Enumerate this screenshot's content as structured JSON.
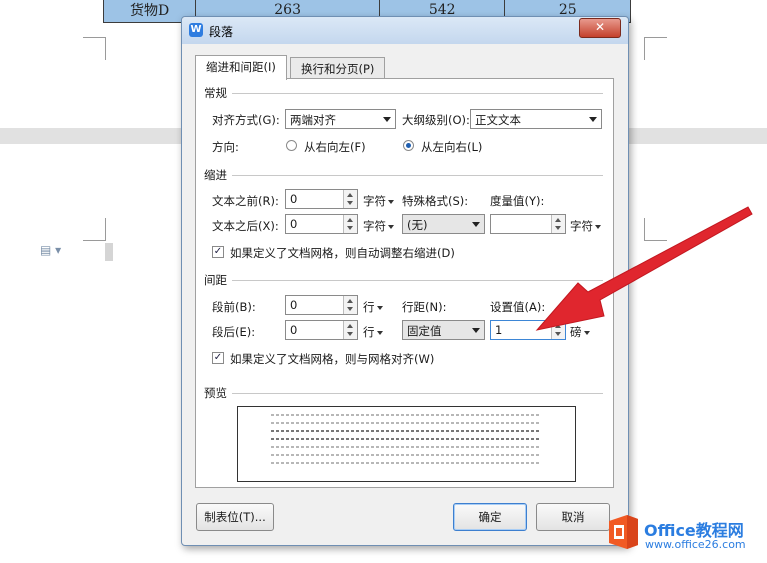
{
  "background": {
    "table_row": [
      "货物D",
      "263",
      "542",
      "25"
    ]
  },
  "dialog": {
    "title": "段落",
    "close_label": "✕",
    "tabs": [
      {
        "label": "缩进和间距(I)",
        "active": true
      },
      {
        "label": "换行和分页(P)",
        "active": false
      }
    ],
    "general": {
      "heading": "常规",
      "alignment_label": "对齐方式(G):",
      "alignment_value": "两端对齐",
      "outline_label": "大纲级别(O):",
      "outline_value": "正文文本",
      "direction_label": "方向:",
      "rtl_label": "从右向左(F)",
      "ltr_label": "从左向右(L)",
      "direction_selected": "ltr"
    },
    "indent": {
      "heading": "缩进",
      "before_label": "文本之前(R):",
      "before_value": "0",
      "before_unit": "字符",
      "after_label": "文本之后(X):",
      "after_value": "0",
      "after_unit": "字符",
      "special_label": "特殊格式(S):",
      "special_value": "(无)",
      "measure_label": "度量值(Y):",
      "measure_value": "",
      "measure_unit": "字符",
      "auto_adjust_label": "如果定义了文档网格，则自动调整右缩进(D)",
      "auto_adjust_checked": true
    },
    "spacing": {
      "heading": "间距",
      "before_label": "段前(B):",
      "before_value": "0",
      "before_unit": "行",
      "after_label": "段后(E):",
      "after_value": "0",
      "after_unit": "行",
      "line_label": "行距(N):",
      "line_value": "固定值",
      "setting_label": "设置值(A):",
      "setting_value": "1",
      "setting_unit": "磅",
      "grid_align_label": "如果定义了文档网格，则与网格对齐(W)",
      "grid_align_checked": true
    },
    "preview": {
      "heading": "预览"
    },
    "buttons": {
      "tabs_label": "制表位(T)...",
      "ok_label": "确定",
      "cancel_label": "取消"
    }
  },
  "watermark": {
    "title": "Office教程网",
    "url": "www.office26.com"
  },
  "colors": {
    "annotation_arrow": "#e0262e",
    "watermark_blue": "#2b7de0",
    "watermark_orange": "#f15a24"
  }
}
